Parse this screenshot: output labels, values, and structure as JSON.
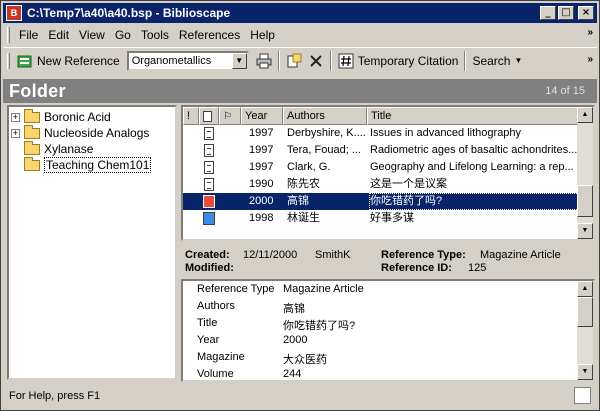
{
  "window": {
    "title": "C:\\Temp7\\a40\\a40.bsp - Biblioscape",
    "app_icon": "biblioscape-icon",
    "controls": [
      "minimize",
      "maximize",
      "close"
    ]
  },
  "menubar": {
    "items": [
      {
        "label": "File"
      },
      {
        "label": "Edit"
      },
      {
        "label": "View"
      },
      {
        "label": "Go"
      },
      {
        "label": "Tools"
      },
      {
        "label": "References"
      },
      {
        "label": "Help"
      }
    ]
  },
  "toolbar": {
    "new_reference_label": "New Reference",
    "folder_combo_value": "Organometallics",
    "temporary_citation_label": "Temporary Citation",
    "search_label": "Search"
  },
  "folder_header": {
    "title": "Folder",
    "count": "14 of 15"
  },
  "tree": {
    "items": [
      {
        "label": "Boronic Acid",
        "expander": "+"
      },
      {
        "label": "Nucleoside Analogs",
        "expander": "+"
      },
      {
        "label": "Xylanase",
        "expander": ""
      },
      {
        "label": "Teaching Chem101",
        "expander": ""
      }
    ]
  },
  "reflist": {
    "columns": {
      "flag": "!",
      "doc": "",
      "marker": "",
      "year": "Year",
      "authors": "Authors",
      "title": "Title"
    },
    "rows": [
      {
        "year": "1997",
        "authors": "Derbyshire, K....",
        "title": "Issues in advanced lithography"
      },
      {
        "year": "1997",
        "authors": "Tera, Fouad; ...",
        "title": "Radiometric ages of basaltic achondrites..."
      },
      {
        "year": "1997",
        "authors": "Clark, G.",
        "title": "Geography and Lifelong Learning: a rep..."
      },
      {
        "year": "1990",
        "authors": "陈先农",
        "title": "这是一个是议案"
      },
      {
        "year": "2000",
        "authors": "高锦",
        "title": "你吃错药了吗?"
      },
      {
        "year": "1998",
        "authors": "林诞生",
        "title": "好事多谋"
      }
    ]
  },
  "detail_head": {
    "created_label": "Created:",
    "created_date": "12/11/2000",
    "created_by": "SmithK",
    "modified_label": "Modified:",
    "reftype_label": "Reference Type:",
    "reftype_value": "Magazine Article",
    "refid_label": "Reference ID:",
    "refid_value": "125"
  },
  "detail": {
    "fields": [
      {
        "label": "Reference Type",
        "value": "Magazine Article"
      },
      {
        "label": "Authors",
        "value": "高锦"
      },
      {
        "label": "Title",
        "value": "你吃错药了吗?"
      },
      {
        "label": "Year",
        "value": "2000"
      },
      {
        "label": "Magazine",
        "value": "大众医药"
      },
      {
        "label": "Volume",
        "value": "244"
      }
    ]
  },
  "statusbar": {
    "text": "For Help, press F1"
  },
  "colors": {
    "titlebar": "#0a246a",
    "selection": "#0a246a",
    "folder_header": "#808080"
  }
}
